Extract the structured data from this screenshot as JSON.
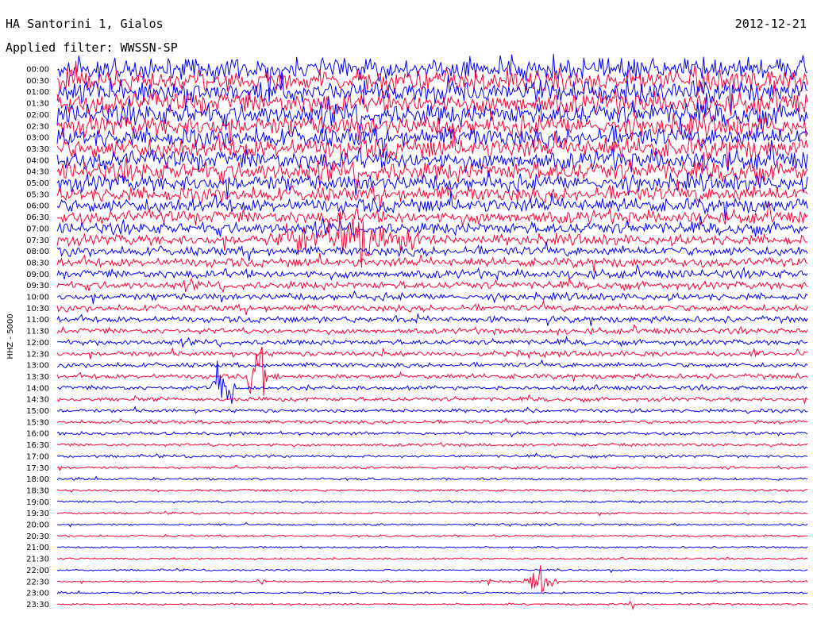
{
  "header": {
    "station": "HA Santorini 1, Gialos",
    "filter": "Applied filter: WWSSN-SP",
    "date": "2012-12-21"
  },
  "colors": {
    "even_row": "#0000ff",
    "odd_row": "#ff0033",
    "background": "#ffffff"
  },
  "chart_data": {
    "type": "line",
    "chart_kind": "helicorder (seismogram)",
    "title": "HA Santorini 1, Gialos",
    "subtitle": "Applied filter: WWSSN-SP",
    "date": "2012-12-21",
    "ylabel": "HHZ - 5000",
    "row_interval_minutes": 30,
    "rows": [
      "00:00",
      "00:30",
      "01:00",
      "01:30",
      "02:00",
      "02:30",
      "03:00",
      "03:30",
      "04:00",
      "04:30",
      "05:00",
      "05:30",
      "06:00",
      "06:30",
      "07:00",
      "07:30",
      "08:00",
      "08:30",
      "09:00",
      "09:30",
      "10:00",
      "10:30",
      "11:00",
      "11:30",
      "12:00",
      "12:30",
      "13:00",
      "13:30",
      "14:00",
      "14:30",
      "15:00",
      "15:30",
      "16:00",
      "16:30",
      "17:00",
      "17:30",
      "18:00",
      "18:30",
      "19:00",
      "19:30",
      "20:00",
      "20:30",
      "21:00",
      "21:30",
      "22:00",
      "22:30",
      "23:00",
      "23:30"
    ],
    "row_colors": [
      "blue",
      "red"
    ],
    "noise_level_per_row": [
      9,
      9,
      9,
      9,
      9,
      8.5,
      8.5,
      8.5,
      8,
      8,
      7,
      6.5,
      6,
      5.5,
      5,
      4.5,
      4,
      3.8,
      3.5,
      3.2,
      3,
      2.8,
      2.6,
      2.4,
      2.2,
      2.2,
      2,
      2,
      1.8,
      1.7,
      1.6,
      1.5,
      1.4,
      1.3,
      1.2,
      1.1,
      1.0,
      1.0,
      0.9,
      0.9,
      0.9,
      0.9,
      0.8,
      0.8,
      0.8,
      0.8,
      0.8,
      0.8
    ],
    "events": [
      {
        "time": "07:30",
        "start_fraction": 0.27,
        "end_fraction": 0.5,
        "amplitude": "high",
        "type": "tremor burst"
      },
      {
        "time": "13:30",
        "start_fraction": 0.25,
        "end_fraction": 0.28,
        "amplitude": "very high",
        "type": "local earthquake"
      },
      {
        "time": "14:00",
        "start_fraction": 0.2,
        "end_fraction": 0.24,
        "amplitude": "high",
        "type": "local earthquake"
      },
      {
        "time": "22:30",
        "start_fraction": 0.27,
        "end_fraction": 0.28,
        "amplitude": "low",
        "type": "small event"
      },
      {
        "time": "22:30",
        "start_fraction": 0.57,
        "end_fraction": 0.58,
        "amplitude": "low",
        "type": "small event"
      },
      {
        "time": "22:30",
        "start_fraction": 0.62,
        "end_fraction": 0.67,
        "amplitude": "medium",
        "type": "regional earthquake"
      },
      {
        "time": "23:30",
        "start_fraction": 0.76,
        "end_fraction": 0.77,
        "amplitude": "low",
        "type": "small event"
      }
    ]
  }
}
